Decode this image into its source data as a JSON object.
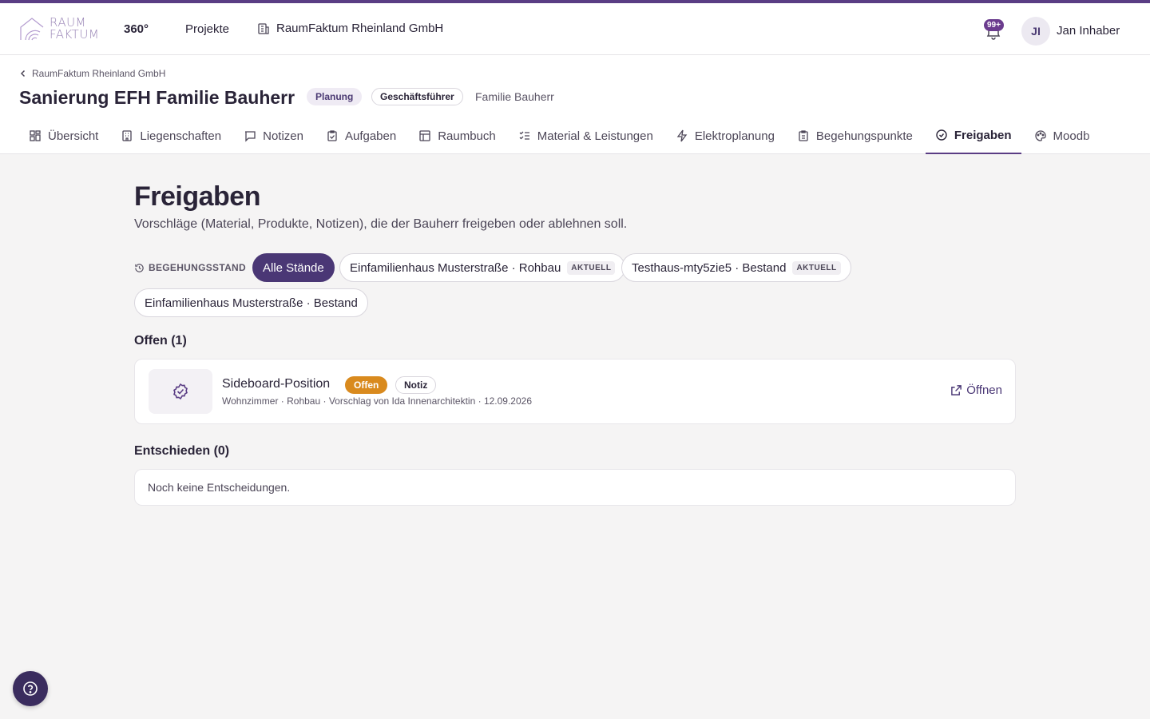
{
  "topbar": {
    "logo_line1": "RAUM",
    "logo_line2": "FAKTUM",
    "logo_suffix": "360°",
    "nav_projekte": "Projekte",
    "nav_company": "RaumFaktum Rheinland GmbH",
    "notifications_badge": "99+",
    "avatar_initials": "JI",
    "user_name": "Jan Inhaber"
  },
  "header": {
    "breadcrumb": "RaumFaktum Rheinland GmbH",
    "title": "Sanierung EFH Familie Bauherr",
    "phase_pill": "Planung",
    "role_pill": "Geschäftsführer",
    "client": "Familie Bauherr",
    "tabs": [
      {
        "label": "Übersicht",
        "icon": "grid-icon"
      },
      {
        "label": "Liegenschaften",
        "icon": "building-icon"
      },
      {
        "label": "Notizen",
        "icon": "message-icon"
      },
      {
        "label": "Aufgaben",
        "icon": "clipboard-check-icon"
      },
      {
        "label": "Raumbuch",
        "icon": "table-icon"
      },
      {
        "label": "Material & Leistungen",
        "icon": "list-check-icon"
      },
      {
        "label": "Elektroplanung",
        "icon": "bolt-icon"
      },
      {
        "label": "Begehungspunkte",
        "icon": "clipboard-icon"
      },
      {
        "label": "Freigaben",
        "icon": "check-badge-icon",
        "active": true
      },
      {
        "label": "Moodb",
        "icon": "palette-icon"
      }
    ]
  },
  "main": {
    "title": "Freigaben",
    "subtitle": "Vorschläge (Material, Produkte, Notizen), die der Bauherr freigeben oder ablehnen soll.",
    "filter": {
      "label": "BEGEHUNGSSTAND",
      "chips": [
        {
          "label": "Alle Stände",
          "active": true
        },
        {
          "label": "Einfamilienhaus Musterstraße · Rohbau",
          "badge": "AKTUELL"
        },
        {
          "label": "Testhaus-mty5zie5 · Bestand",
          "badge": "AKTUELL"
        },
        {
          "label": "Einfamilienhaus Musterstraße · Bestand"
        }
      ]
    },
    "open_section": {
      "heading": "Offen (1)",
      "items": [
        {
          "title": "Sideboard-Position",
          "status": "Offen",
          "type": "Notiz",
          "meta": "Wohnzimmer · Rohbau · Vorschlag von Ida Innenarchitektin · 12.09.2026",
          "action": "Öffnen"
        }
      ]
    },
    "decided_section": {
      "heading": "Entschieden (0)",
      "empty": "Noch keine Entscheidungen."
    }
  },
  "colors": {
    "accent": "#4a3775",
    "top_border": "#5a3d84",
    "status_open": "#d98a1e"
  }
}
